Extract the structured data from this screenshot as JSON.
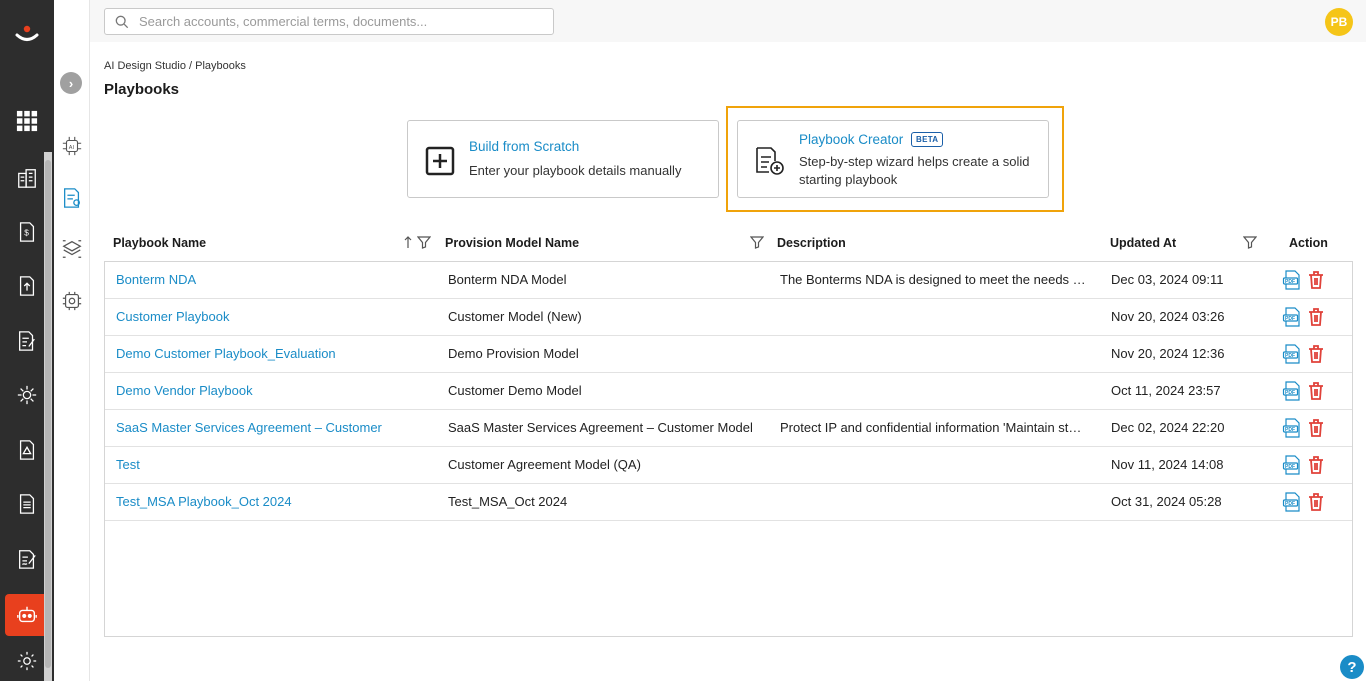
{
  "search": {
    "placeholder": "Search accounts, commercial terms, documents..."
  },
  "user": {
    "initials": "PB"
  },
  "breadcrumb": "AI Design Studio / Playbooks",
  "page_title": "Playbooks",
  "cards": {
    "scratch": {
      "title": "Build from Scratch",
      "desc": "Enter your playbook details manually"
    },
    "creator": {
      "title": "Playbook Creator",
      "badge": "BETA",
      "desc": "Step-by-step wizard helps create a solid starting playbook"
    }
  },
  "table": {
    "headers": {
      "name": "Playbook Name",
      "model": "Provision Model Name",
      "desc": "Description",
      "updated": "Updated At",
      "action": "Action"
    },
    "rows": [
      {
        "name": "Bonterm NDA",
        "model": "Bonterm NDA Model",
        "desc": "The Bonterms NDA is designed to meet the needs …",
        "updated": "Dec 03, 2024 09:11"
      },
      {
        "name": "Customer Playbook",
        "model": "Customer Model (New)",
        "desc": "",
        "updated": "Nov 20, 2024 03:26"
      },
      {
        "name": "Demo Customer Playbook_Evaluation",
        "model": "Demo Provision Model",
        "desc": "",
        "updated": "Nov 20, 2024 12:36"
      },
      {
        "name": "Demo Vendor Playbook",
        "model": "Customer Demo Model",
        "desc": "",
        "updated": "Oct 11, 2024 23:57"
      },
      {
        "name": "SaaS Master Services Agreement – Customer",
        "model": "SaaS Master Services Agreement – Customer Model",
        "desc": "Protect IP and confidential information 'Maintain st…",
        "updated": "Dec 02, 2024 22:20"
      },
      {
        "name": "Test",
        "model": "Customer Agreement Model (QA)",
        "desc": "",
        "updated": "Nov 11, 2024 14:08"
      },
      {
        "name": "Test_MSA Playbook_Oct 2024",
        "model": "Test_MSA_Oct 2024",
        "desc": "",
        "updated": "Oct 31, 2024 05:28"
      }
    ]
  },
  "icons": {
    "rail": [
      "logo-icon",
      "grid-icon",
      "building-icon",
      "dollar-doc-icon",
      "upload-doc-icon",
      "edit-doc-icon",
      "gear-network-icon",
      "warning-doc-icon",
      "doc-list-icon",
      "signature-doc-icon",
      "robot-icon",
      "gear-icon"
    ],
    "secondary": [
      "chevron-right-icon",
      "ai-chip-icon",
      "playbook-doc-icon",
      "layers-icon",
      "chip-gear-icon"
    ]
  },
  "colors": {
    "accent": "#1a8cc7",
    "highlight": "#f0a30a",
    "active_nav": "#e8401e",
    "delete": "#e0423a",
    "avatar": "#f5c518"
  },
  "help_label": "?"
}
